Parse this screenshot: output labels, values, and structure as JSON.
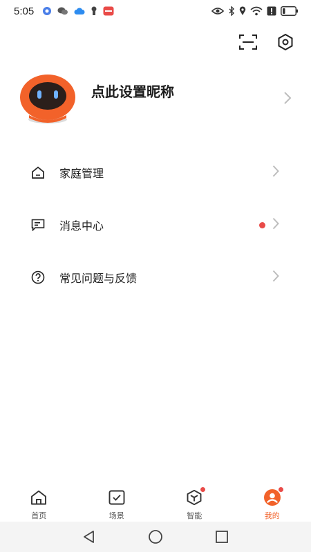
{
  "status_bar": {
    "time": "5:05",
    "battery_level": 0.2
  },
  "top_actions": {
    "scan_icon": "scan-icon",
    "settings_icon": "hexagon-settings-icon"
  },
  "profile": {
    "nickname": "点此设置昵称",
    "avatar_color": "#f2622a"
  },
  "menu": {
    "items": [
      {
        "label": "家庭管理",
        "icon": "home-icon",
        "has_dot": false
      },
      {
        "label": "消息中心",
        "icon": "message-icon",
        "has_dot": true
      },
      {
        "label": "常见问题与反馈",
        "icon": "help-icon",
        "has_dot": false
      }
    ]
  },
  "tabbar": {
    "tabs": [
      {
        "label": "首页",
        "icon": "home-icon",
        "active": false,
        "badge": false
      },
      {
        "label": "场景",
        "icon": "scene-check-icon",
        "active": false,
        "badge": false
      },
      {
        "label": "智能",
        "icon": "cube-icon",
        "active": false,
        "badge": true
      },
      {
        "label": "我的",
        "icon": "profile-icon",
        "active": true,
        "badge": true
      }
    ]
  },
  "colors": {
    "accent": "#f2622a",
    "dot": "#e94b48"
  }
}
